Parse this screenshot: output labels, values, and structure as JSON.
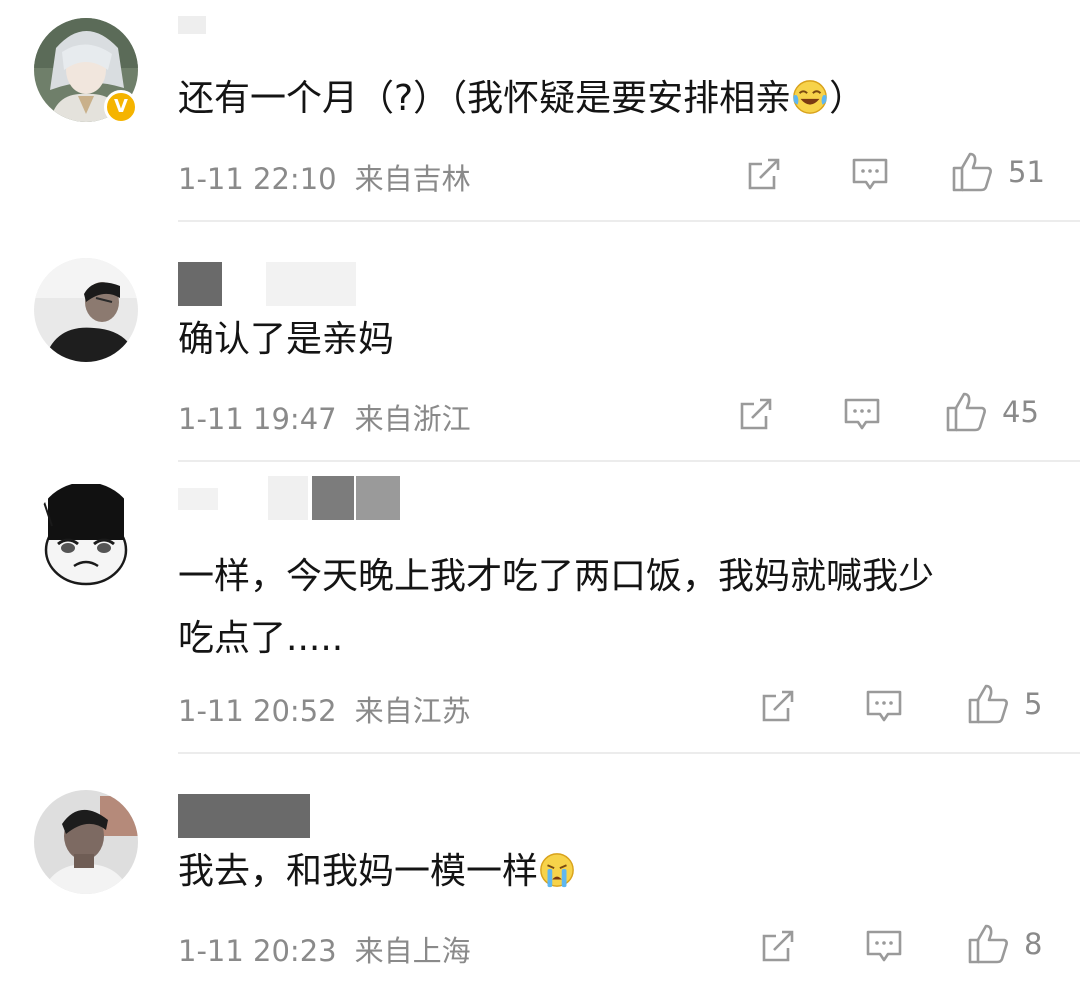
{
  "comments": [
    {
      "text_before": "还有一个月（?）（我怀疑是要安排相亲",
      "text_after": "）",
      "emoji": "laughing-crying-emoji",
      "time": "1-11 22:10",
      "location": "来自吉林",
      "likes": "51",
      "verified": true
    },
    {
      "text": "确认了是亲妈",
      "time": "1-11 19:47",
      "location": "来自浙江",
      "likes": "45"
    },
    {
      "text_line1": "一样，今天晚上我才吃了两口饭，我妈就喊我少",
      "text_line2": "吃点了.....",
      "time": "1-11 20:52",
      "location": "来自江苏",
      "likes": "5"
    },
    {
      "text_before": "我去，和我妈一模一样",
      "emoji": "crying-emoji",
      "time": "1-11 20:23",
      "location": "来自上海",
      "likes": "8"
    }
  ],
  "icons": {
    "share": "share-icon",
    "reply": "comment-icon",
    "like": "thumbs-up-icon"
  },
  "colors": {
    "text": "#141414",
    "meta": "#8a8a8a",
    "icon": "#9a9a9a",
    "divider": "#ececec",
    "verified": "#f5b400"
  }
}
